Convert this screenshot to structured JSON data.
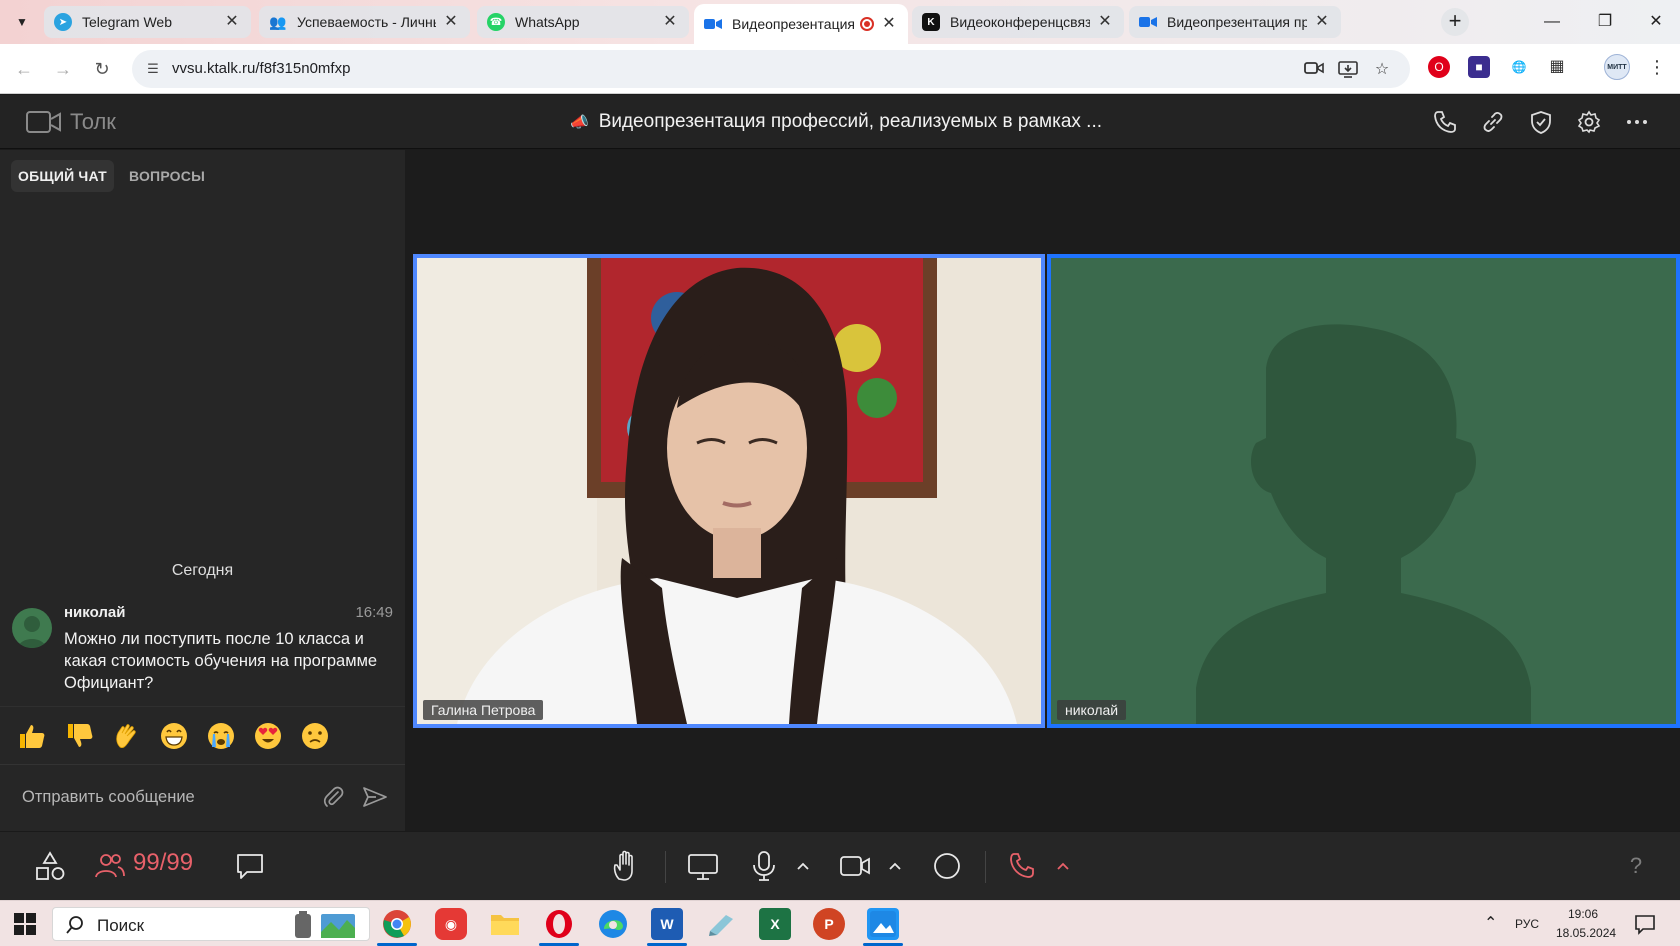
{
  "browser": {
    "tabs": [
      {
        "title": "Telegram Web",
        "favicon": "telegram-icon",
        "color": "#2aa3e0",
        "active": false
      },
      {
        "title": "Успеваемость - Личные к",
        "favicon": "people-icon",
        "color": "#333333",
        "active": false
      },
      {
        "title": "WhatsApp",
        "favicon": "whatsapp-icon",
        "color": "#25d366",
        "active": false
      },
      {
        "title": "Видеопрезентация пр",
        "favicon": "video-icon",
        "color": "#1a73e8",
        "active": true,
        "recording": true
      },
      {
        "title": "Видеоконференцсвязь ро",
        "favicon": "k-icon",
        "color": "#111111",
        "active": false
      },
      {
        "title": "Видеопрезентация профе",
        "favicon": "video-icon",
        "color": "#1a73e8",
        "active": false
      }
    ],
    "url": "vvsu.ktalk.ru/f8f315n0mfxp",
    "profile_label": "МИТТ"
  },
  "app": {
    "logo_text": "Толк",
    "conference_title": "Видеопрезентация профессий, реализуемых в рамках ..."
  },
  "chat": {
    "tabs": [
      {
        "label": "ОБЩИЙ ЧАТ",
        "active": true
      },
      {
        "label": "ВОПРОСЫ",
        "active": false
      }
    ],
    "day_label": "Сегодня",
    "messages": [
      {
        "author": "николай",
        "time": "16:49",
        "text": "Можно ли поступить после 10 класса и какая стоимость обучения на программе Официант?"
      }
    ],
    "reactions": [
      "thumbs-up-emoji",
      "thumbs-down-emoji",
      "waving-hand-emoji",
      "grinning-emoji",
      "crying-emoji",
      "heart-eyes-emoji",
      "confused-emoji"
    ],
    "compose_placeholder": "Отправить сообщение"
  },
  "video": {
    "participants": [
      {
        "name": "Галина Петрова",
        "video": true
      },
      {
        "name": "николай",
        "video": false
      }
    ]
  },
  "controls": {
    "participants_count": "99/99",
    "accent_color": "#e8616a"
  },
  "taskbar": {
    "search_label": "Поиск",
    "language": "РУС",
    "time": "19:06",
    "date": "18.05.2024"
  }
}
